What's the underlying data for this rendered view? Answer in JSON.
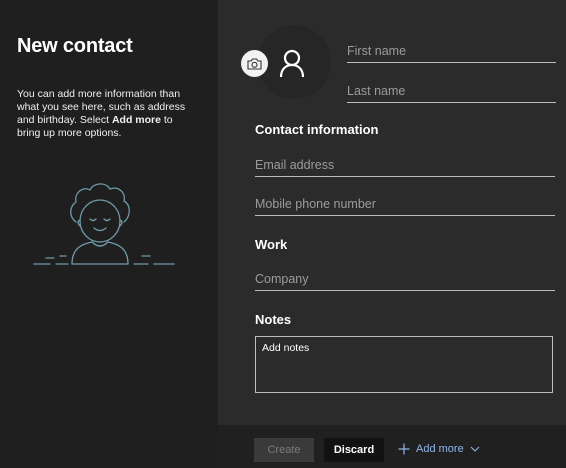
{
  "sidebar": {
    "title": "New contact",
    "description_before": "You can add more information than what you see here, such as address and birthday. Select ",
    "description_bold": "Add more",
    "description_after": " to bring up more options."
  },
  "form": {
    "first_name_placeholder": "First name",
    "last_name_placeholder": "Last name",
    "contact_info_title": "Contact information",
    "email_placeholder": "Email address",
    "mobile_placeholder": "Mobile phone number",
    "work_title": "Work",
    "company_placeholder": "Company",
    "notes_title": "Notes",
    "notes_placeholder": "Add notes"
  },
  "footer": {
    "create_label": "Create",
    "discard_label": "Discard",
    "add_more_label": "Add more"
  },
  "colors": {
    "sidebar_bg": "#1f1f1f",
    "panel_bg": "#2b2b2b",
    "link_accent": "#8fb7ea",
    "illustration_stroke": "#6f9ba8"
  },
  "icons": {
    "camera": "camera-icon",
    "person": "person-icon",
    "plus": "plus-icon",
    "chevron": "chevron-down-icon"
  }
}
